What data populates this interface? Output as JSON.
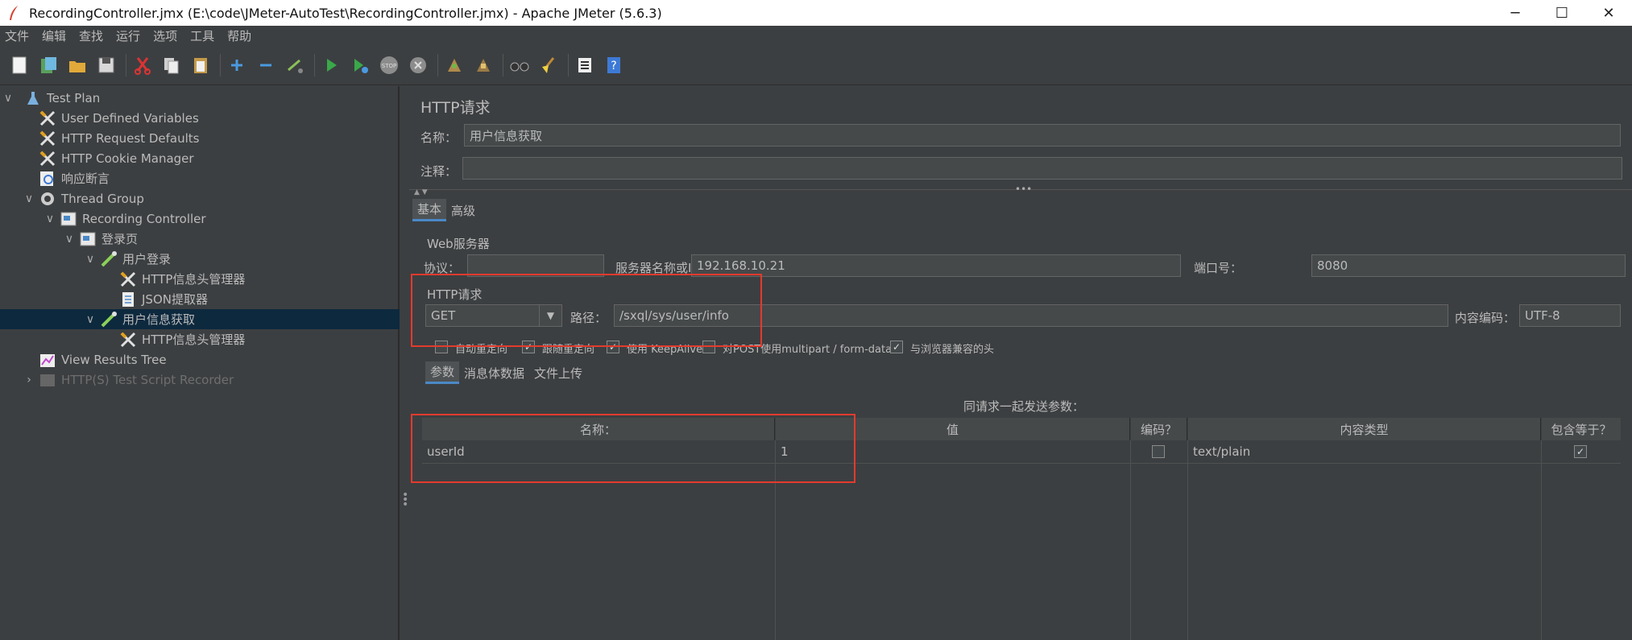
{
  "window": {
    "title": "RecordingController.jmx (E:\\code\\JMeter-AutoTest\\RecordingController.jmx) - Apache JMeter (5.6.3)",
    "minimize": "─",
    "maximize": "☐",
    "close": "✕"
  },
  "menu": [
    "文件",
    "编辑",
    "查找",
    "运行",
    "选项",
    "工具",
    "帮助"
  ],
  "tree": [
    {
      "label": "Test Plan",
      "level": 0,
      "expanded": true
    },
    {
      "label": "User Defined Variables",
      "level": 1
    },
    {
      "label": "HTTP Request Defaults",
      "level": 1
    },
    {
      "label": "HTTP Cookie Manager",
      "level": 1
    },
    {
      "label": "响应断言",
      "level": 1
    },
    {
      "label": "Thread Group",
      "level": 1,
      "expanded": true
    },
    {
      "label": "Recording Controller",
      "level": 2,
      "expanded": true
    },
    {
      "label": "登录页",
      "level": 3,
      "expanded": true
    },
    {
      "label": "用户登录",
      "level": 4,
      "expanded": true
    },
    {
      "label": "HTTP信息头管理器",
      "level": 5
    },
    {
      "label": "JSON提取器",
      "level": 5
    },
    {
      "label": "用户信息获取",
      "level": 4,
      "expanded": true,
      "selected": true
    },
    {
      "label": "HTTP信息头管理器",
      "level": 5
    },
    {
      "label": "View Results Tree",
      "level": 1
    },
    {
      "label": "HTTP(S) Test Script Recorder",
      "level": 1,
      "collapsed": true,
      "disabled": true
    }
  ],
  "editor": {
    "title": "HTTP请求",
    "name_label": "名称：",
    "name_value": "用户信息获取",
    "comment_label": "注释：",
    "comment_value": "",
    "tabs": [
      "基本",
      "高级"
    ],
    "web_server": {
      "group_title": "Web服务器",
      "protocol_label": "协议：",
      "protocol_value": "",
      "server_label": "服务器名称或IP：",
      "server_value": "192.168.10.21",
      "port_label": "端口号：",
      "port_value": "8080"
    },
    "http_request": {
      "group_title": "HTTP请求",
      "method": "GET",
      "path_label": "路径：",
      "path_value": "/sxql/sys/user/info",
      "encoding_label": "内容编码：",
      "encoding_value": "UTF-8"
    },
    "options": [
      {
        "label": "自动重定向",
        "checked": false
      },
      {
        "label": "跟随重定向",
        "checked": true
      },
      {
        "label": "使用 KeepAlive",
        "checked": true
      },
      {
        "label": "对POST使用multipart / form-data",
        "checked": false
      },
      {
        "label": "与浏览器兼容的头",
        "checked": true
      }
    ],
    "subtabs": [
      "参数",
      "消息体数据",
      "文件上传"
    ],
    "params_caption": "同请求一起发送参数：",
    "params_columns": [
      "名称：",
      "值",
      "编码？",
      "内容类型",
      "包含等于？"
    ],
    "params_rows": [
      {
        "name": "userId",
        "value": "1",
        "encode": false,
        "content_type": "text/plain",
        "include_equals": true
      }
    ]
  },
  "colors": {
    "background": "#3c3f41",
    "selected_row": "#0d293e",
    "highlight_box": "#e33a2e",
    "tab_accent": "#4a88c7"
  }
}
